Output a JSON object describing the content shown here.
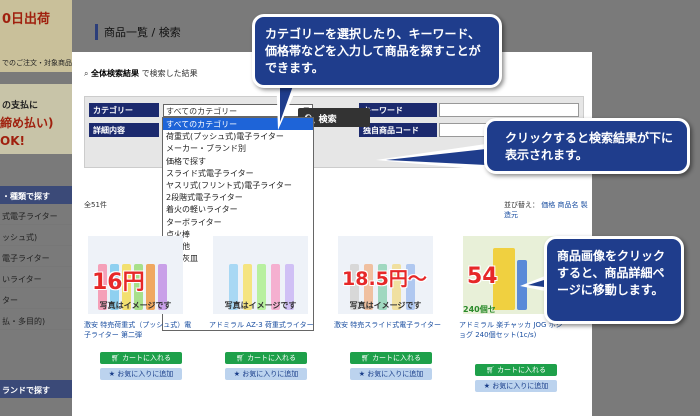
{
  "left": {
    "banner_top": "0日出荷",
    "banner_sub": "でのご注文・対象商品",
    "box_a": "の支払に",
    "box_b": "締め払い)",
    "box_c": "OK!",
    "nav_head": "・種類で探す",
    "nav_items": [
      "式電子ライター",
      "ッシュ式)",
      "電子ライター",
      "いライター",
      "ター",
      "払・多目的)"
    ],
    "nav_head2": "ランドで探す"
  },
  "breadcrumb": "商品一覧 / 検索",
  "results_title": "全体検索結果",
  "results_suffix": "で検索した結果",
  "form": {
    "category_label": "カテゴリー",
    "category_value": "すべてのカテゴリー",
    "keyword_label": "キーワード",
    "detail_label": "詳細内容",
    "code_label": "独自商品コード",
    "search_button": "検索"
  },
  "dropdown_options": [
    "すべてのカテゴリー",
    "荷重式(プッシュ式)電子ライター",
    "メーカー・ブランド別",
    "価格で探す",
    "スライド式電子ライター",
    "ヤスリ式(フリント式)電子ライター",
    "2段階式電子ライター",
    "着火の軽いライター",
    "ターボライター",
    "点火棒",
    "その他",
    "携帯灰皿"
  ],
  "count": "全51件",
  "sort": {
    "label": "並び替え：",
    "options": [
      "価格",
      "商品名",
      "製造元"
    ]
  },
  "products": [
    {
      "price": "16円",
      "note": "写真はイメージです",
      "name": "激安 特売荷重式（プッシュ式）電子ライター 第二弾"
    },
    {
      "price": "",
      "note": "写真はイメージです",
      "name": "アドミラル AZ-3 荷重式ライター"
    },
    {
      "price": "18.5円〜",
      "note": "写真はイメージです",
      "name": "激安 特売スライド式電子ライター"
    },
    {
      "price": "54",
      "note": "240個セ",
      "name": "アドミラル 楽チャッカ JOG ホジョグ 240個セット(1c/s)"
    }
  ],
  "cart_label": "カートに入れる",
  "fav_label": "お気に入りに追加",
  "bubbles": {
    "b1": "カテゴリーを選択したり、キーワード、価格帯などを入力して商品を探すことができます。",
    "b2": "クリックすると検索結果が下に表示されます。",
    "b3": "商品画像をクリックすると、商品詳細ページに移動します。"
  }
}
